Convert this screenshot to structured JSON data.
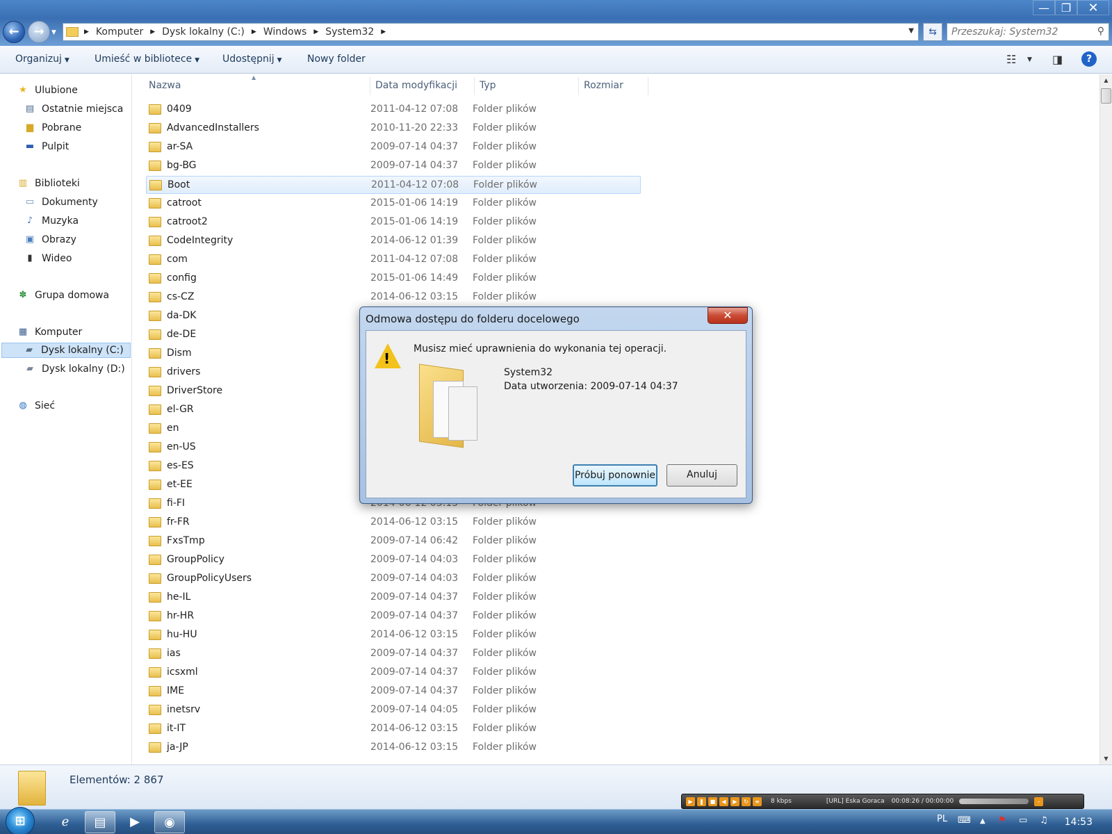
{
  "window": {
    "minimize_glyph": "—",
    "maximize_glyph": "❐",
    "close_glyph": "✕"
  },
  "address": {
    "crumbs": [
      "Komputer",
      "Dysk lokalny (C:)",
      "Windows",
      "System32"
    ],
    "search_placeholder": "Przeszukaj: System32"
  },
  "toolbar": {
    "organize": "Organizuj",
    "include_library": "Umieść w bibliotece",
    "share": "Udostępnij",
    "new_folder": "Nowy folder",
    "help": "?"
  },
  "sidebar": {
    "favorites": "Ulubione",
    "recent": "Ostatnie miejsca",
    "downloads": "Pobrane",
    "desktop": "Pulpit",
    "libraries": "Biblioteki",
    "documents": "Dokumenty",
    "music": "Muzyka",
    "pictures": "Obrazy",
    "videos": "Wideo",
    "homegroup": "Grupa domowa",
    "computer": "Komputer",
    "drive_c": "Dysk lokalny (C:)",
    "drive_d": "Dysk lokalny (D:)",
    "network": "Sieć"
  },
  "columns": {
    "name": "Nazwa",
    "date": "Data modyfikacji",
    "type": "Typ",
    "size": "Rozmiar"
  },
  "files": [
    {
      "name": "0409",
      "date": "2011-04-12 07:08",
      "type": "Folder plików"
    },
    {
      "name": "AdvancedInstallers",
      "date": "2010-11-20 22:33",
      "type": "Folder plików"
    },
    {
      "name": "ar-SA",
      "date": "2009-07-14 04:37",
      "type": "Folder plików"
    },
    {
      "name": "bg-BG",
      "date": "2009-07-14 04:37",
      "type": "Folder plików"
    },
    {
      "name": "Boot",
      "date": "2011-04-12 07:08",
      "type": "Folder plików"
    },
    {
      "name": "catroot",
      "date": "2015-01-06 14:19",
      "type": "Folder plików"
    },
    {
      "name": "catroot2",
      "date": "2015-01-06 14:19",
      "type": "Folder plików"
    },
    {
      "name": "CodeIntegrity",
      "date": "2014-06-12 01:39",
      "type": "Folder plików"
    },
    {
      "name": "com",
      "date": "2011-04-12 07:08",
      "type": "Folder plików"
    },
    {
      "name": "config",
      "date": "2015-01-06 14:49",
      "type": "Folder plików"
    },
    {
      "name": "cs-CZ",
      "date": "2014-06-12 03:15",
      "type": "Folder plików"
    },
    {
      "name": "da-DK",
      "date": "",
      "type": ""
    },
    {
      "name": "de-DE",
      "date": "",
      "type": ""
    },
    {
      "name": "Dism",
      "date": "",
      "type": ""
    },
    {
      "name": "drivers",
      "date": "",
      "type": ""
    },
    {
      "name": "DriverStore",
      "date": "",
      "type": ""
    },
    {
      "name": "el-GR",
      "date": "",
      "type": ""
    },
    {
      "name": "en",
      "date": "",
      "type": ""
    },
    {
      "name": "en-US",
      "date": "",
      "type": ""
    },
    {
      "name": "es-ES",
      "date": "",
      "type": ""
    },
    {
      "name": "et-EE",
      "date": "",
      "type": ""
    },
    {
      "name": "fi-FI",
      "date": "2014-06-12 03:15",
      "type": "Folder plików"
    },
    {
      "name": "fr-FR",
      "date": "2014-06-12 03:15",
      "type": "Folder plików"
    },
    {
      "name": "FxsTmp",
      "date": "2009-07-14 06:42",
      "type": "Folder plików"
    },
    {
      "name": "GroupPolicy",
      "date": "2009-07-14 04:03",
      "type": "Folder plików"
    },
    {
      "name": "GroupPolicyUsers",
      "date": "2009-07-14 04:03",
      "type": "Folder plików"
    },
    {
      "name": "he-IL",
      "date": "2009-07-14 04:37",
      "type": "Folder plików"
    },
    {
      "name": "hr-HR",
      "date": "2009-07-14 04:37",
      "type": "Folder plików"
    },
    {
      "name": "hu-HU",
      "date": "2014-06-12 03:15",
      "type": "Folder plików"
    },
    {
      "name": "ias",
      "date": "2009-07-14 04:37",
      "type": "Folder plików"
    },
    {
      "name": "icsxml",
      "date": "2009-07-14 04:37",
      "type": "Folder plików"
    },
    {
      "name": "IME",
      "date": "2009-07-14 04:37",
      "type": "Folder plików"
    },
    {
      "name": "inetsrv",
      "date": "2009-07-14 04:05",
      "type": "Folder plików"
    },
    {
      "name": "it-IT",
      "date": "2014-06-12 03:15",
      "type": "Folder plików"
    },
    {
      "name": "ja-JP",
      "date": "2014-06-12 03:15",
      "type": "Folder plików"
    }
  ],
  "selected_file": "Boot",
  "details": {
    "count": "Elementów: 2 867"
  },
  "dialog": {
    "title": "Odmowa dostępu do folderu docelowego",
    "message": "Musisz mieć uprawnienia do wykonania tej operacji.",
    "folder_name": "System32",
    "created": "Data utworzenia: 2009-07-14 04:37",
    "retry": "Próbuj ponownie",
    "cancel": "Anuluj",
    "close_glyph": "✕"
  },
  "media_player": {
    "bitrate": "8 kbps",
    "station": "[URL] Eska Goraca",
    "time": "00:08:26 / 00:00:00"
  },
  "taskbar": {
    "language": "PL",
    "time": "14:53"
  },
  "colors": {
    "accent": "#2b5aa3",
    "selection": "#cde3f8",
    "warning": "#f3c21b",
    "close_red": "#c94b34"
  }
}
